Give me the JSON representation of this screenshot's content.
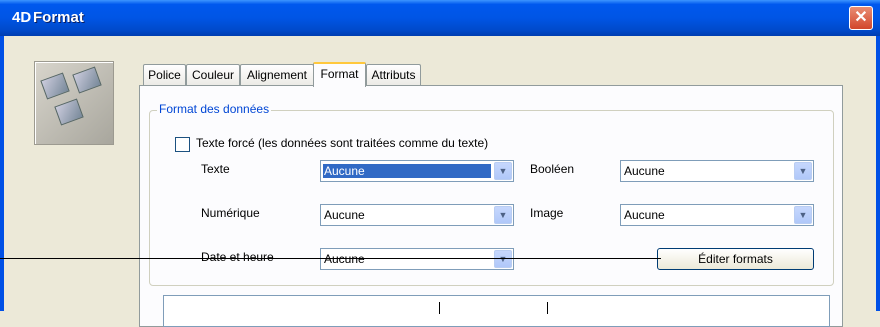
{
  "window": {
    "title": "Format",
    "title_logo": "4D",
    "close_icon": "close-icon"
  },
  "tabs": [
    {
      "label": "Police",
      "active": false
    },
    {
      "label": "Couleur",
      "active": false
    },
    {
      "label": "Alignement",
      "active": false
    },
    {
      "label": "Format",
      "active": true
    },
    {
      "label": "Attributs",
      "active": false
    }
  ],
  "group": {
    "legend": "Format des données"
  },
  "checkbox": {
    "label": "Texte forcé (les données sont traitées comme du texte)",
    "checked": false
  },
  "fields": {
    "texte": {
      "label": "Texte",
      "value": "Aucune",
      "selected": true
    },
    "booleen": {
      "label": "Booléen",
      "value": "Aucune"
    },
    "numerique": {
      "label": "Numérique",
      "value": "Aucune"
    },
    "image": {
      "label": "Image",
      "value": "Aucune"
    },
    "date": {
      "label": "Date et heure",
      "value": "Aucune"
    }
  },
  "edit_button": {
    "label": "Éditer formats"
  },
  "colors": {
    "title_bar": "#0055e5",
    "tab_highlight": "#ffc83c",
    "selection": "#316ac5",
    "legend": "#0046d5"
  }
}
